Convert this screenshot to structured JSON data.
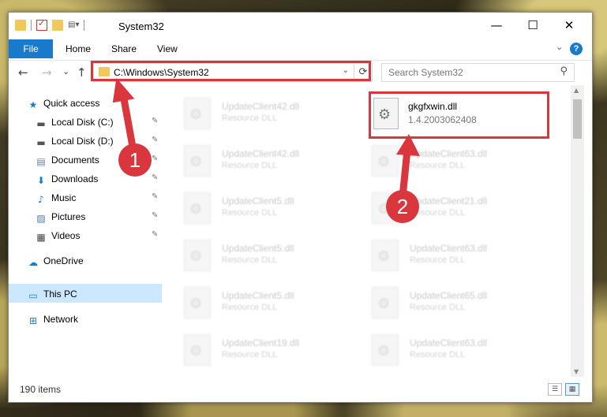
{
  "window": {
    "title": "System32",
    "minimize": "—",
    "maximize": "☐",
    "close": "✕"
  },
  "ribbon": {
    "tabs": [
      "File",
      "Home",
      "Share",
      "View"
    ],
    "help": "?"
  },
  "nav": {
    "back": "←",
    "forward": "→",
    "recent": "⌄",
    "up": "↑",
    "address": "C:\\Windows\\System32",
    "refresh": "⟳",
    "search_placeholder": "Search System32"
  },
  "sidebar": {
    "items": [
      {
        "label": "Quick access",
        "icon": "star-icon",
        "pinned": false
      },
      {
        "label": "Local Disk (C:)",
        "icon": "drive-icon",
        "pinned": true
      },
      {
        "label": "Local Disk (D:)",
        "icon": "drive-icon",
        "pinned": true
      },
      {
        "label": "Documents",
        "icon": "documents-icon",
        "pinned": true
      },
      {
        "label": "Downloads",
        "icon": "download-icon",
        "pinned": true
      },
      {
        "label": "Music",
        "icon": "music-icon",
        "pinned": true
      },
      {
        "label": "Pictures",
        "icon": "pictures-icon",
        "pinned": true
      },
      {
        "label": "Videos",
        "icon": "videos-icon",
        "pinned": true
      },
      {
        "label": "OneDrive",
        "icon": "cloud-icon",
        "pinned": false
      },
      {
        "label": "This PC",
        "icon": "computer-icon",
        "pinned": false,
        "selected": true
      },
      {
        "label": "Network",
        "icon": "network-icon",
        "pinned": false
      }
    ]
  },
  "files_left": [
    {
      "name": "UpdateClient42.dll",
      "desc": "Resource DLL"
    },
    {
      "name": "UpdateClient42.dll",
      "desc": "Resource DLL"
    },
    {
      "name": "UpdateClient5.dll",
      "desc": "Resource DLL"
    },
    {
      "name": "UpdateClient5.dll",
      "desc": "Resource DLL"
    },
    {
      "name": "UpdateClient5.dll",
      "desc": "Resource DLL"
    },
    {
      "name": "UpdateClient19.dll",
      "desc": "Resource DLL"
    }
  ],
  "files_right": [
    {
      "name": "UpdateClient63.dll",
      "desc": "Resource DLL"
    },
    {
      "name": "UpdateClient21.dll",
      "desc": "Resource DLL"
    },
    {
      "name": "UpdateClient63.dll",
      "desc": "Resource DLL"
    },
    {
      "name": "UpdateClient65.dll",
      "desc": "Resource DLL"
    },
    {
      "name": "UpdateClient63.dll",
      "desc": "Resource DLL"
    }
  ],
  "target_file": {
    "name": "gkgfxwin.dll",
    "version": "1.4.2003062408"
  },
  "status": {
    "item_count": "190 items"
  },
  "markers": [
    "1",
    "2"
  ],
  "colors": {
    "accent": "#1979ca",
    "highlight": "#d9363e",
    "selection": "#cce8ff"
  }
}
